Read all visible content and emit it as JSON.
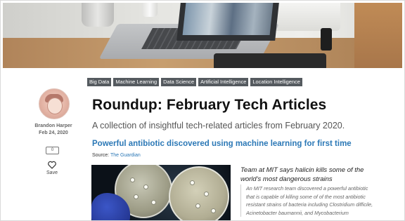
{
  "tags": [
    "Big Data",
    "Machine Learning",
    "Data Science",
    "Artificial Intelligence",
    "Location Intelligence"
  ],
  "author": {
    "name": "Brandon Harper",
    "date": "Feb 24, 2020"
  },
  "actions": {
    "comments_count": "0",
    "save_label": "Save"
  },
  "article": {
    "title": "Roundup: February Tech Articles",
    "subtitle": "A collection of insightful tech-related articles from February 2020."
  },
  "item": {
    "title": "Powerful antibiotic discovered using machine learning for first time",
    "source_label": "Source:",
    "source_name": "The Guardian",
    "quote_head": "Team at MIT says halicin kills some of the world's most dangerous strains",
    "quote_lines": [
      "An MIT research team discovered a powerful antibiotic",
      "that is capable of killing some of of the most antibiotic",
      "resistant strains of bacteria including Clostridium difficile,",
      "Acinetobacter baumannii, and Mycobacterium"
    ]
  },
  "colors": {
    "accent": "#2b78b6",
    "tag_bg": "#555a5f"
  },
  "icons": [
    "comment-icon",
    "heart-icon"
  ]
}
